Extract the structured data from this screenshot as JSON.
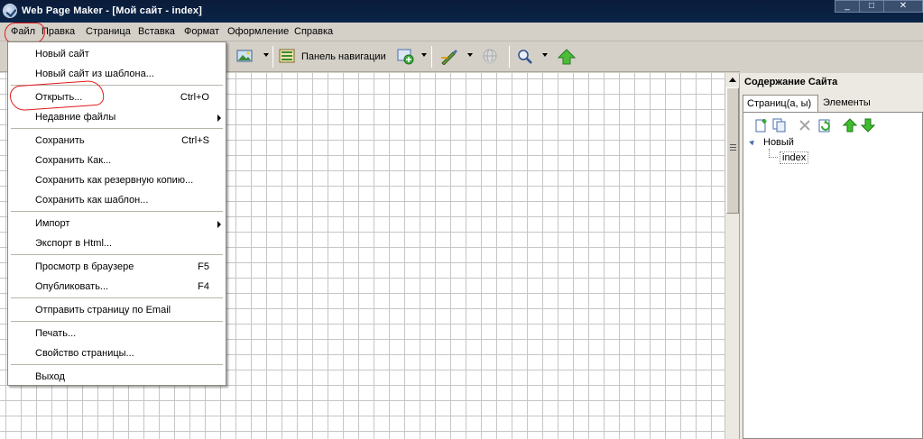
{
  "window": {
    "title": "Web Page Maker - [Мой сайт - index]",
    "controls": {
      "minimize": "_",
      "maximize": "□",
      "close": "✕"
    }
  },
  "menubar": {
    "items": [
      "Файл",
      "Правка",
      "Страница",
      "Вставка",
      "Формат",
      "Оформление",
      "Справка"
    ]
  },
  "toolbar": {
    "navigation_panel_label": "Панель навигации",
    "icons": [
      "image-icon",
      "navigation-panel-icon",
      "insert-object-icon",
      "brush-icon",
      "globe-icon",
      "zoom-icon",
      "upload-arrow-icon"
    ]
  },
  "file_menu": {
    "items": [
      {
        "label": "Новый сайт",
        "shortcut": ""
      },
      {
        "label": "Новый сайт из шаблона...",
        "shortcut": ""
      },
      {
        "label": "Открыть...",
        "shortcut": "Ctrl+O"
      },
      {
        "label": "Недавние файлы",
        "shortcut": "",
        "submenu": true
      },
      {
        "label": "Сохранить",
        "shortcut": "Ctrl+S"
      },
      {
        "label": "Сохранить Как...",
        "shortcut": ""
      },
      {
        "label": "Сохранить как резервную копию...",
        "shortcut": ""
      },
      {
        "label": "Сохранить как шаблон...",
        "shortcut": ""
      },
      {
        "label": "Импорт",
        "shortcut": "",
        "submenu": true
      },
      {
        "label": "Экспорт в Html...",
        "shortcut": ""
      },
      {
        "label": "Просмотр в браузере",
        "shortcut": "F5"
      },
      {
        "label": "Опубликовать...",
        "shortcut": "F4"
      },
      {
        "label": "Отправить страницу по Email",
        "shortcut": ""
      },
      {
        "label": "Печать...",
        "shortcut": ""
      },
      {
        "label": "Свойство страницы...",
        "shortcut": ""
      },
      {
        "label": "Выход",
        "shortcut": ""
      }
    ]
  },
  "site_panel": {
    "title": "Содержание Сайта",
    "tabs": [
      "Страниц(а, ы)",
      "Элементы"
    ],
    "tree": {
      "root": "Новый",
      "child": "index"
    }
  },
  "colors": {
    "titlebar": "#0a2447",
    "annotation": "#e01a1a",
    "grid": "#c6c6c6"
  }
}
